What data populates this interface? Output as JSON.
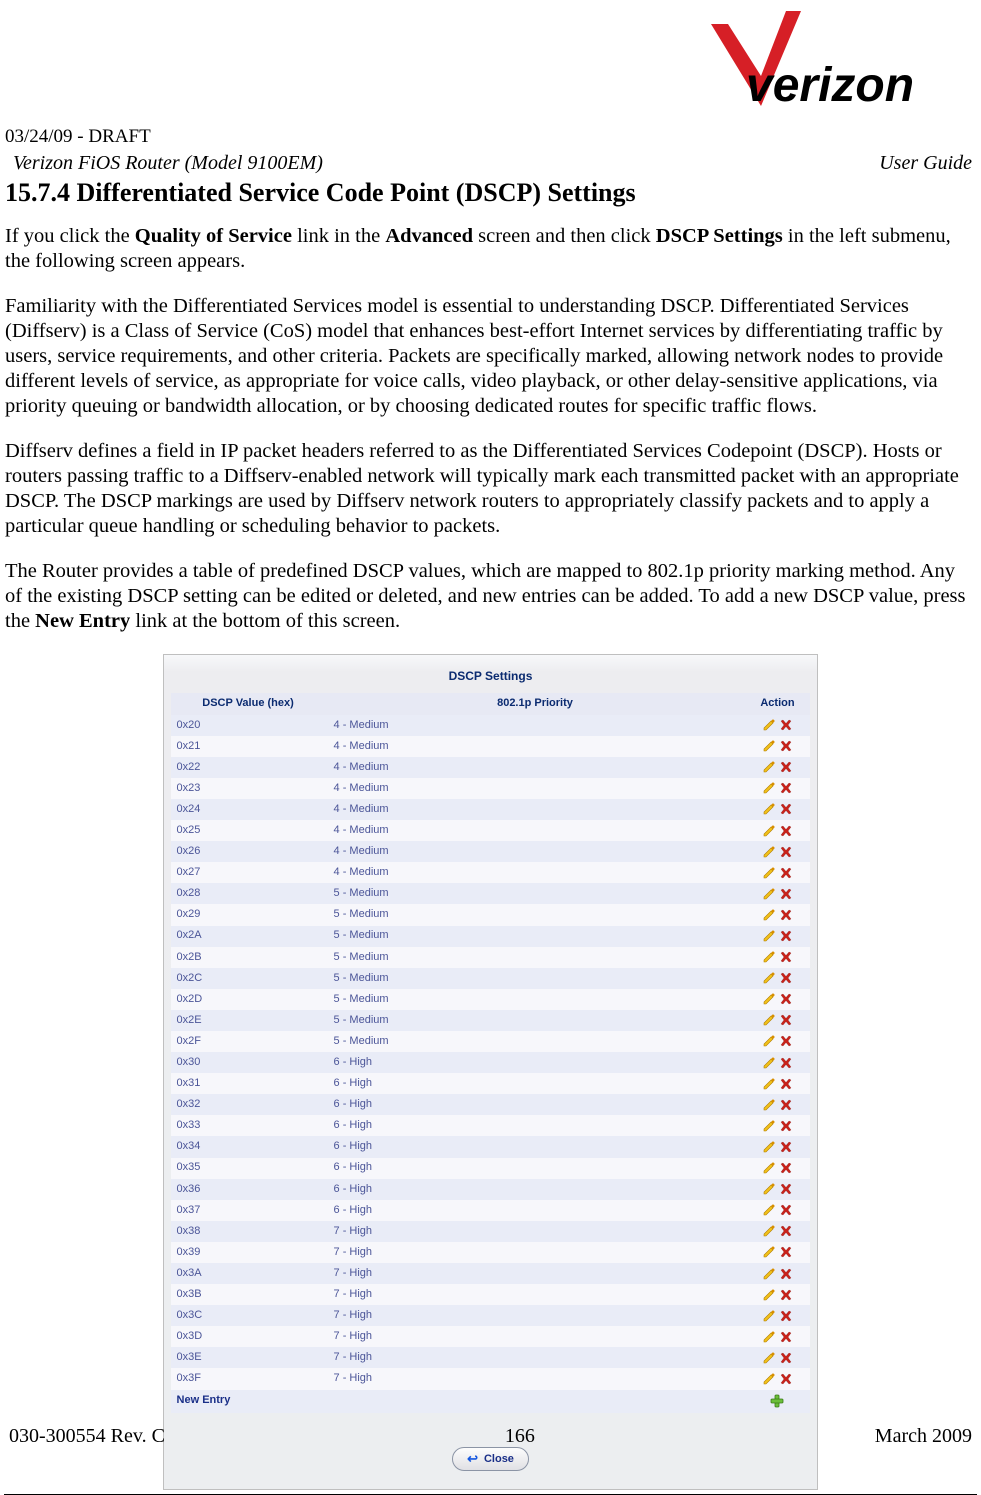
{
  "header": {
    "draft_line": "03/24/09 - DRAFT",
    "product_line": "Verizon FiOS Router (Model 9100EM)",
    "right_label": "User Guide"
  },
  "section": {
    "number": "15.7.4",
    "title": "Differentiated Service Code Point (DSCP) Settings"
  },
  "paragraphs": {
    "p1a": "If you click the ",
    "p1_bold1": "Quality of Service",
    "p1b": " link in the ",
    "p1_bold2": "Advanced",
    "p1c": " screen and then click ",
    "p1_bold3": "DSCP Settings",
    "p1d": " in the left submenu, the following screen appears.",
    "p2": "Familiarity with the Differentiated Services model is essential to understanding DSCP. Differentiated Services (Diffserv) is a Class of Service (CoS) model that enhances best-effort Internet services by differentiating traffic by users, service requirements, and other criteria. Packets are specifically marked, allowing network nodes to provide different levels of service, as appropriate for voice calls, video playback, or other delay-sensitive applications, via priority queuing or bandwidth allocation, or by choosing dedicated routes for specific traffic flows.",
    "p3": "Diffserv defines a field in IP packet headers referred to as the Differentiated Services Codepoint (DSCP). Hosts or routers passing traffic to a Diffserv-enabled network will typically mark each transmitted packet with an appropriate DSCP. The DSCP markings are used by Diffserv network routers to appropriately classify packets and to apply a particular queue handling or scheduling behavior to packets.",
    "p4a": "The Router provides a table of predefined DSCP values, which are mapped to 802.1p priority marking method. Any of the existing DSCP setting can be edited or deleted, and new entries can be added. To add a new DSCP value, press the ",
    "p4_bold1": "New Entry",
    "p4b": " link at the bottom of this screen."
  },
  "screenshot": {
    "title": "DSCP Settings",
    "columns": [
      "DSCP Value (hex)",
      "802.1p Priority",
      "Action"
    ],
    "rows": [
      {
        "dscp": "0x20",
        "pri": "4 - Medium"
      },
      {
        "dscp": "0x21",
        "pri": "4 - Medium"
      },
      {
        "dscp": "0x22",
        "pri": "4 - Medium"
      },
      {
        "dscp": "0x23",
        "pri": "4 - Medium"
      },
      {
        "dscp": "0x24",
        "pri": "4 - Medium"
      },
      {
        "dscp": "0x25",
        "pri": "4 - Medium"
      },
      {
        "dscp": "0x26",
        "pri": "4 - Medium"
      },
      {
        "dscp": "0x27",
        "pri": "4 - Medium"
      },
      {
        "dscp": "0x28",
        "pri": "5 - Medium"
      },
      {
        "dscp": "0x29",
        "pri": "5 - Medium"
      },
      {
        "dscp": "0x2A",
        "pri": "5 - Medium"
      },
      {
        "dscp": "0x2B",
        "pri": "5 - Medium"
      },
      {
        "dscp": "0x2C",
        "pri": "5 - Medium"
      },
      {
        "dscp": "0x2D",
        "pri": "5 - Medium"
      },
      {
        "dscp": "0x2E",
        "pri": "5 - Medium"
      },
      {
        "dscp": "0x2F",
        "pri": "5 - Medium"
      },
      {
        "dscp": "0x30",
        "pri": "6 - High"
      },
      {
        "dscp": "0x31",
        "pri": "6 - High"
      },
      {
        "dscp": "0x32",
        "pri": "6 - High"
      },
      {
        "dscp": "0x33",
        "pri": "6 - High"
      },
      {
        "dscp": "0x34",
        "pri": "6 - High"
      },
      {
        "dscp": "0x35",
        "pri": "6 - High"
      },
      {
        "dscp": "0x36",
        "pri": "6 - High"
      },
      {
        "dscp": "0x37",
        "pri": "6 - High"
      },
      {
        "dscp": "0x38",
        "pri": "7 - High"
      },
      {
        "dscp": "0x39",
        "pri": "7 - High"
      },
      {
        "dscp": "0x3A",
        "pri": "7 - High"
      },
      {
        "dscp": "0x3B",
        "pri": "7 - High"
      },
      {
        "dscp": "0x3C",
        "pri": "7 - High"
      },
      {
        "dscp": "0x3D",
        "pri": "7 - High"
      },
      {
        "dscp": "0x3E",
        "pri": "7 - High"
      },
      {
        "dscp": "0x3F",
        "pri": "7 - High"
      }
    ],
    "new_entry_label": "New Entry",
    "close_label": "Close"
  },
  "footer": {
    "left": "030-300554 Rev. C",
    "center": "166",
    "right": "March 2009"
  }
}
